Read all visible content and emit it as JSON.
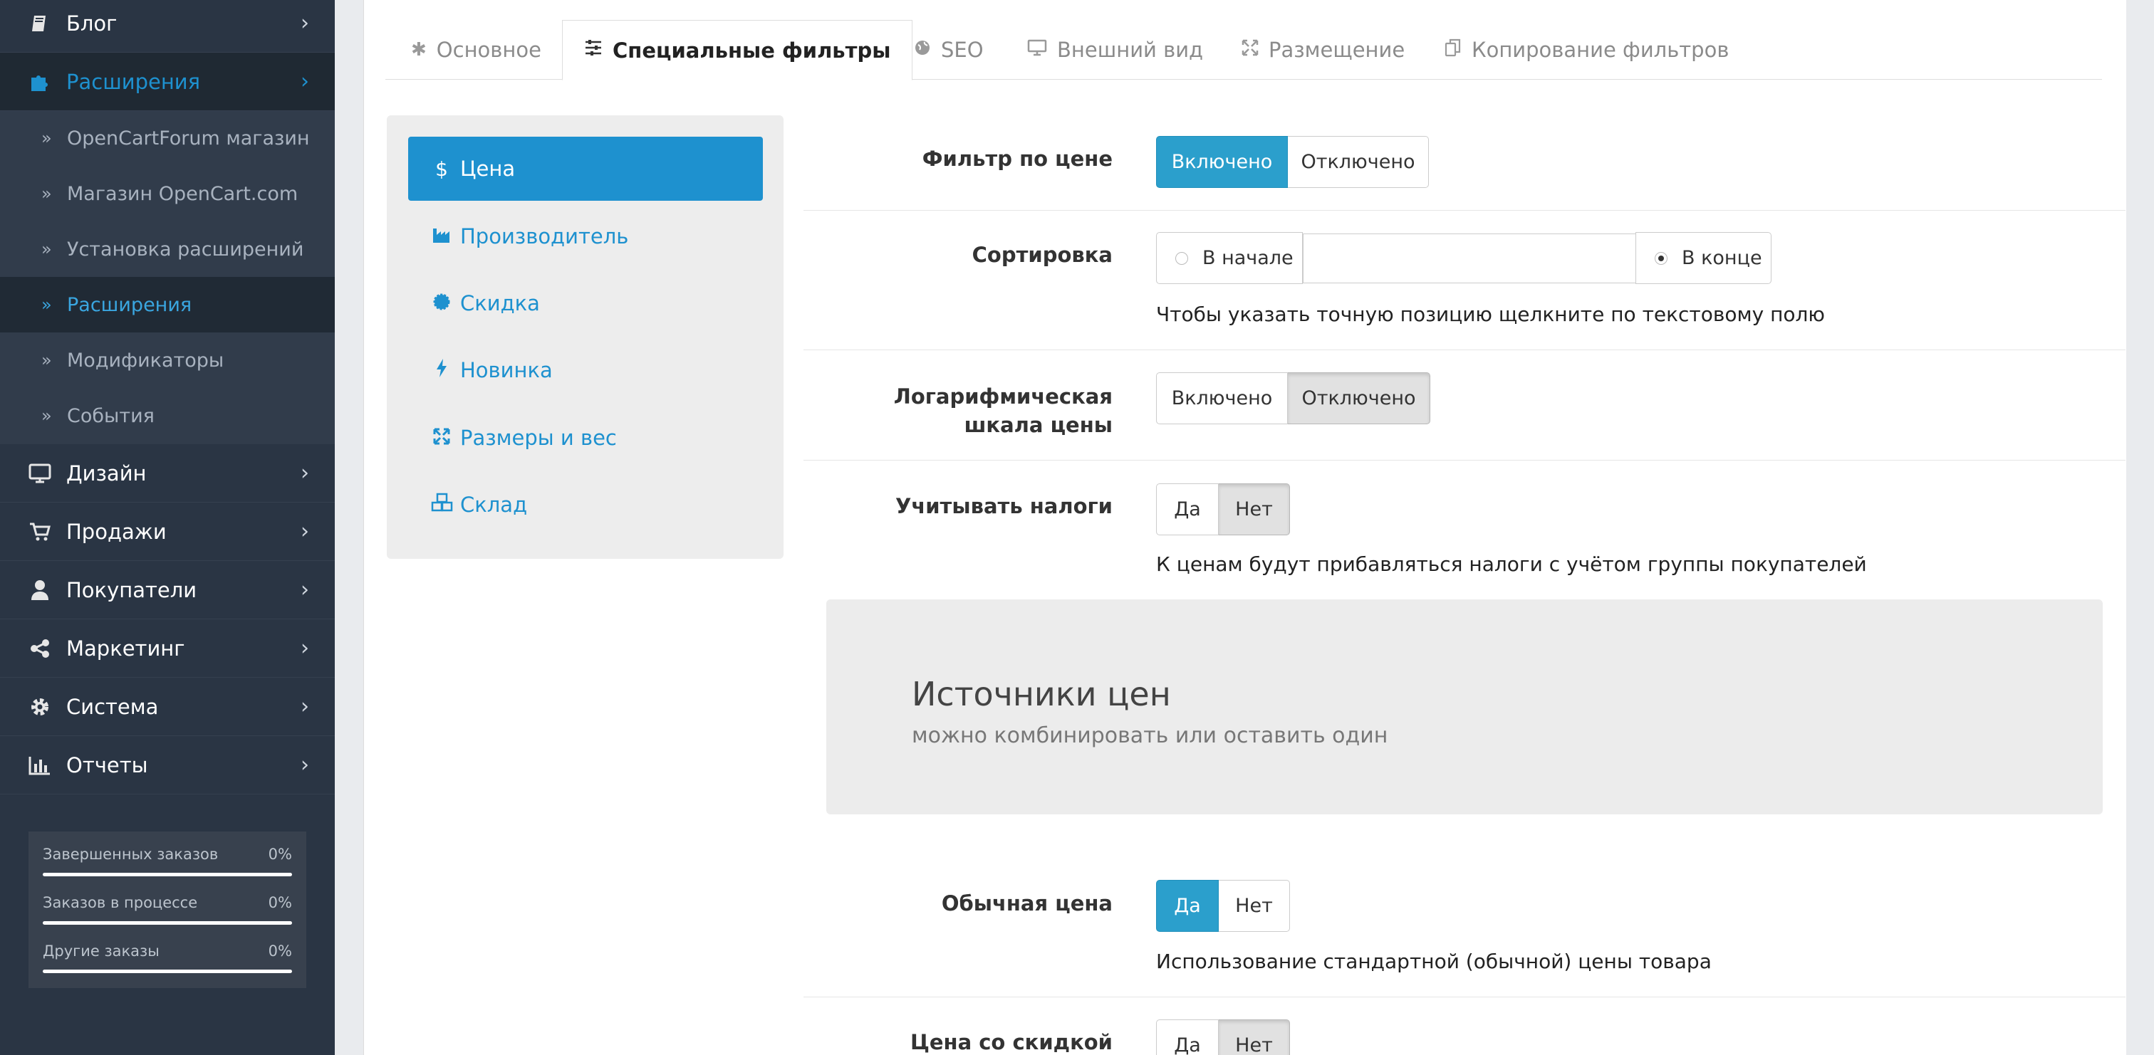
{
  "sidebar": {
    "top_items": [
      {
        "label": "Блог",
        "icon": "book-icon"
      },
      {
        "label": "Расширения",
        "icon": "puzzle-icon"
      }
    ],
    "sub_items": [
      "OpenCartForum магазин",
      "Магазин OpenCart.com",
      "Установка расширений",
      "Расширения",
      "Модификаторы",
      "События"
    ],
    "bottom_items": [
      {
        "label": "Дизайн",
        "icon": "monitor-icon"
      },
      {
        "label": "Продажи",
        "icon": "cart-icon"
      },
      {
        "label": "Покупатели",
        "icon": "user-icon"
      },
      {
        "label": "Маркетинг",
        "icon": "share-icon"
      },
      {
        "label": "Система",
        "icon": "gear-icon"
      },
      {
        "label": "Отчеты",
        "icon": "bar-chart-icon"
      }
    ],
    "stats": [
      {
        "label": "Завершенных заказов",
        "value": "0%"
      },
      {
        "label": "Заказов в процессе",
        "value": "0%"
      },
      {
        "label": "Другие заказы",
        "value": "0%"
      }
    ]
  },
  "tabs": [
    {
      "label": "Основное",
      "icon": "asterisk-icon"
    },
    {
      "label": "Специальные фильтры",
      "icon": "sliders-icon"
    },
    {
      "label": "SEO",
      "icon": "globe-icon"
    },
    {
      "label": "Внешний вид",
      "icon": "monitor-icon"
    },
    {
      "label": "Размещение",
      "icon": "arrows-icon"
    },
    {
      "label": "Копирование фильтров",
      "icon": "copy-icon"
    }
  ],
  "vmenu": [
    {
      "label": "Цена",
      "icon": "dollar-icon"
    },
    {
      "label": "Производитель",
      "icon": "industry-icon"
    },
    {
      "label": "Скидка",
      "icon": "certificate-icon"
    },
    {
      "label": "Новинка",
      "icon": "bolt-icon"
    },
    {
      "label": "Размеры и вес",
      "icon": "expand-icon"
    },
    {
      "label": "Склад",
      "icon": "cubes-icon"
    }
  ],
  "form": {
    "price_filter": {
      "label": "Фильтр по цене",
      "on": "Включено",
      "off": "Отключено"
    },
    "sorting": {
      "label": "Сортировка",
      "start": "В начале",
      "end": "В конце",
      "help": "Чтобы указать точную позицию щелкните по текстовому полю"
    },
    "log_scale": {
      "label": "Логарифмическая шкала цены",
      "on": "Включено",
      "off": "Отключено"
    },
    "taxes": {
      "label": "Учитывать налоги",
      "yes": "Да",
      "no": "Нет",
      "help": "К ценам будут прибавляться налоги с учётом группы покупателей"
    },
    "sources": {
      "title": "Источники цен",
      "subtitle": "можно комбинировать или оставить один"
    },
    "regular_price": {
      "label": "Обычная цена",
      "yes": "Да",
      "no": "Нет",
      "help": "Использование стандартной (обычной) цены товара"
    },
    "discount_price": {
      "label": "Цена со скидкой",
      "yes": "Да",
      "no": "Нет"
    }
  },
  "colors": {
    "accent": "#1e91cf",
    "toggle_on": "#2b9fcc",
    "sidebar_bg": "#2a3544"
  }
}
